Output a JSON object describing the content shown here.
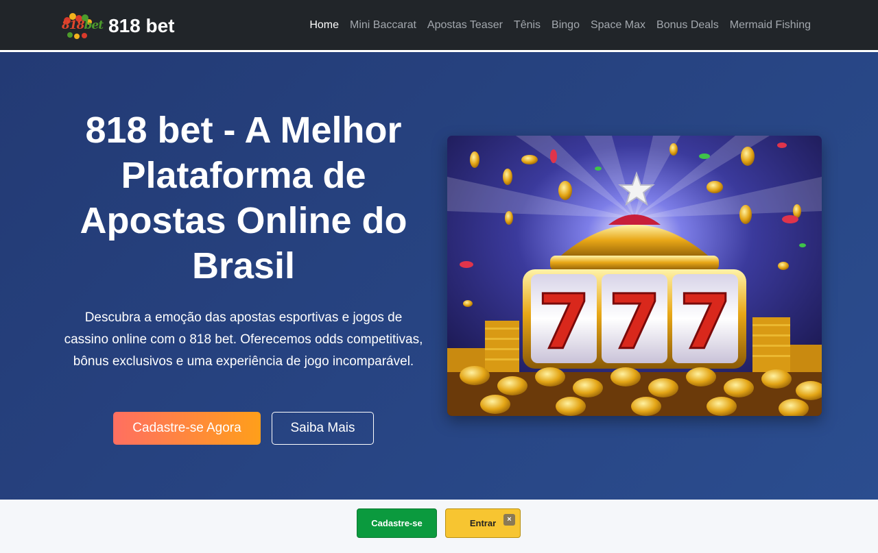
{
  "header": {
    "logo_text_1": "818",
    "logo_text_2": "bet",
    "brand_name": "818 bet",
    "nav": [
      {
        "label": "Home",
        "active": true
      },
      {
        "label": "Mini Baccarat"
      },
      {
        "label": "Apostas Teaser"
      },
      {
        "label": "Tênis"
      },
      {
        "label": "Bingo"
      },
      {
        "label": "Space Max"
      },
      {
        "label": "Bonus Deals"
      },
      {
        "label": "Mermaid Fishing"
      }
    ]
  },
  "hero": {
    "title": "818 bet - A Melhor Plataforma de Apostas Online do Brasil",
    "description": "Descubra a emoção das apostas esportivas e jogos de cassino online com o 818 bet. Oferecemos odds competitivas, bônus exclusivos e uma experiência de jogo incomparável.",
    "primary_button": "Cadastre-se Agora",
    "secondary_button": "Saiba Mais",
    "image_icon": "slot-machine-777-image"
  },
  "floating_bar": {
    "signup_label": "Cadastre-se",
    "login_label": "Entrar",
    "close_label": "×"
  },
  "colors": {
    "navbar": "#212529",
    "hero_bg": "#2b4d8f",
    "primary_gradient_start": "#ff6f61",
    "primary_gradient_end": "#ff9f1a",
    "signup_green": "#0b9a3e",
    "login_yellow": "#f7c531"
  }
}
